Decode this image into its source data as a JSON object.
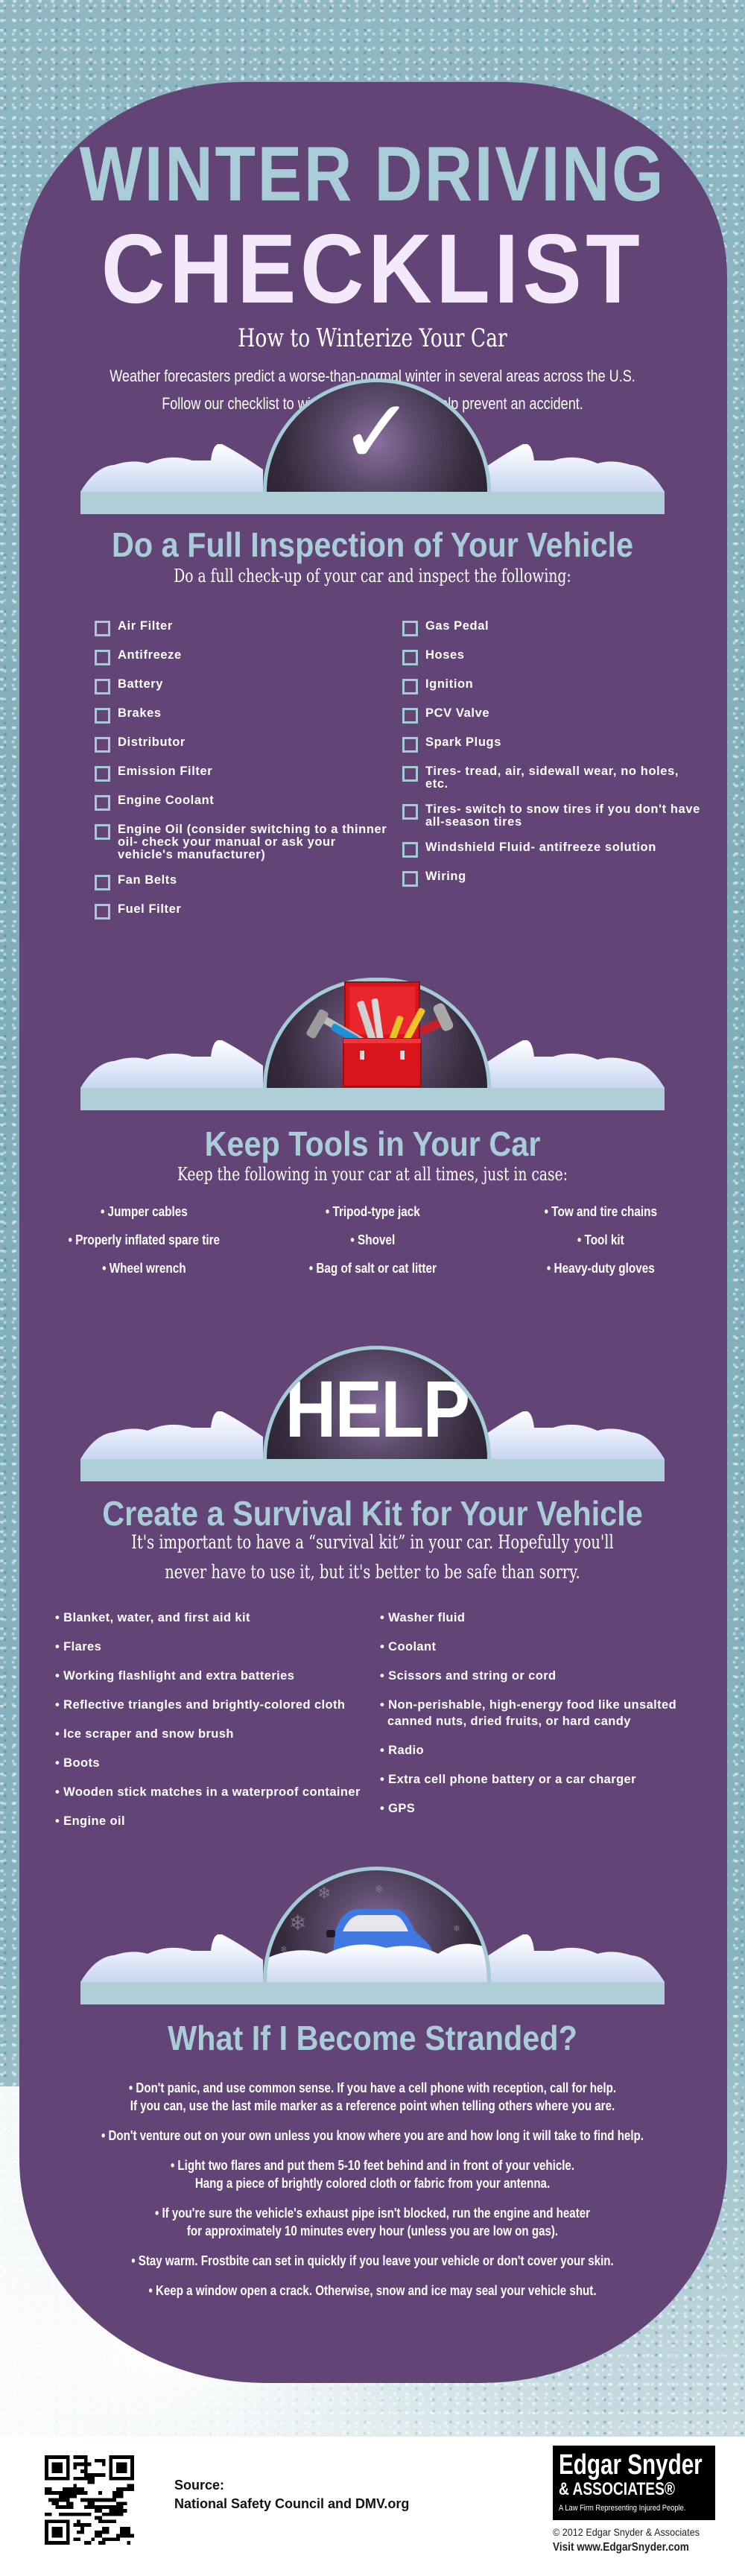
{
  "header": {
    "title_line1": "WINTER DRIVING",
    "title_line2": "CHECKLIST",
    "subtitle": "How to Winterize Your Car",
    "intro_line1": "Weather forecasters predict a worse-than-normal winter in several areas across the U.S.",
    "intro_line2": "Follow our checklist to winterize your car and help prevent an accident."
  },
  "colors": {
    "card_purple": "#624476",
    "accent_blue": "#a9cdd6",
    "title_light": "#f4e8fb",
    "background_blue": "#86b3bf"
  },
  "inspection": {
    "icon": "checkmark-icon",
    "icon_glyph": "✓",
    "title": "Do a Full Inspection of Your Vehicle",
    "subtitle": "Do a full check-up of your car and inspect the following:",
    "left_items": [
      "Air Filter",
      "Antifreeze",
      "Battery",
      "Brakes",
      "Distributor",
      "Emission Filter",
      "Engine Coolant",
      "Engine Oil (consider switching to a thinner oil- check your manual or ask your vehicle's manufacturer)",
      "Fan Belts",
      "Fuel Filter"
    ],
    "right_items": [
      "Gas Pedal",
      "Hoses",
      "Ignition",
      "PCV Valve",
      "Spark Plugs",
      "Tires- tread, air, sidewall wear, no holes, etc.",
      "Tires- switch to snow tires if you don't have all-season tires",
      "Windshield Fluid- antifreeze solution",
      "Wiring"
    ]
  },
  "tools": {
    "icon": "toolbox-icon",
    "title": "Keep Tools in Your Car",
    "subtitle": "Keep the following in your car at all times, just in case:",
    "items": [
      "Jumper cables",
      "Tripod-type jack",
      "Tow and tire chains",
      "Properly inflated spare tire",
      "Shovel",
      "Tool kit",
      "Wheel wrench",
      "Bag of salt or cat litter",
      "Heavy-duty gloves"
    ]
  },
  "survival": {
    "icon": "help-sign-icon",
    "icon_text": "HELP",
    "title": "Create a Survival Kit for Your Vehicle",
    "subtitle_line1": "It's important to have a “survival kit” in your car. Hopefully you'll",
    "subtitle_line2": "never have to use it, but it's better to be safe than sorry.",
    "left_items": [
      "Blanket, water, and first aid kit",
      "Flares",
      "Working flashlight and extra batteries",
      "Reflective triangles and brightly-colored cloth",
      "Ice scraper and snow brush",
      "Boots",
      "Wooden stick matches in a waterproof container",
      "Engine oil"
    ],
    "right_items": [
      "Washer fluid",
      "Coolant",
      "Scissors and string or cord",
      "Non-perishable, high-energy food like unsalted canned nuts, dried fruits, or hard candy",
      "Radio",
      "Extra cell phone battery or a car charger",
      "GPS"
    ]
  },
  "stranded": {
    "icon": "snowed-in-car-icon",
    "title": "What If I Become Stranded?",
    "items": [
      {
        "line1": "• Don't panic, and use common sense. If you have a cell phone with reception, call for help.",
        "line2": "If you can, use the last mile marker as a reference point when telling others where you are."
      },
      {
        "line1": "• Don't venture out on your own unless you know where you are and how long it will take to find help.",
        "line2": ""
      },
      {
        "line1": "• Light two flares and put them 5-10 feet behind and in front of your vehicle.",
        "line2": "Hang a piece of brightly colored cloth or fabric from your antenna."
      },
      {
        "line1": "• If you're sure the vehicle's exhaust pipe isn't blocked, run the engine and heater",
        "line2": "for approximately 10 minutes every hour (unless you are low on gas)."
      },
      {
        "line1": "• Stay warm. Frostbite can set in quickly if you leave your vehicle or don't cover your skin.",
        "line2": ""
      },
      {
        "line1": "• Keep a window open a crack. Otherwise, snow and ice may seal your vehicle shut.",
        "line2": ""
      }
    ]
  },
  "footer": {
    "qr_icon": "qr-code-icon",
    "source_label": "Source:",
    "source_text": "National Safety Council and DMV.org",
    "logo_name": "Edgar Snyder",
    "logo_associates": "& ASSOCIATES®",
    "logo_tagline": "A Law Firm Representing Injured People.",
    "copyright": "© 2012 Edgar Snyder & Associates",
    "visit": "Visit www.EdgarSnyder.com"
  }
}
